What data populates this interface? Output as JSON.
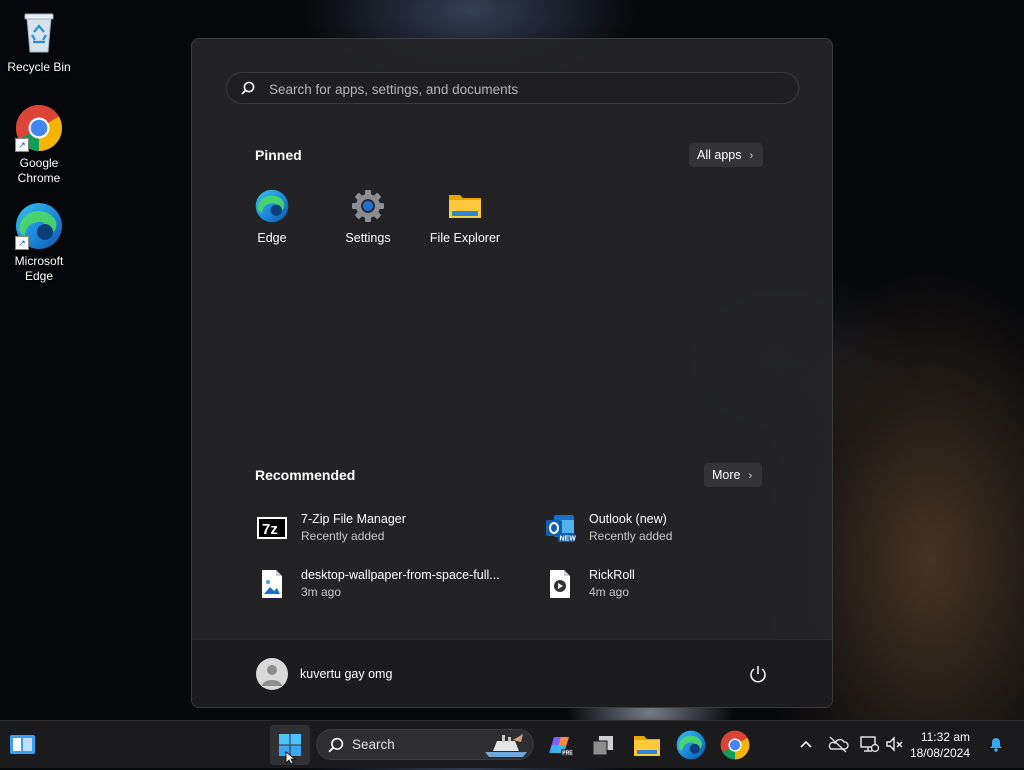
{
  "desktop": {
    "icons": [
      {
        "label": "Recycle Bin"
      },
      {
        "label": "Google Chrome"
      },
      {
        "label": "Microsoft Edge"
      }
    ]
  },
  "start_menu": {
    "search_placeholder": "Search for apps, settings, and documents",
    "pinned": {
      "title": "Pinned",
      "all_apps_label": "All apps",
      "items": [
        {
          "label": "Edge",
          "icon": "edge-icon"
        },
        {
          "label": "Settings",
          "icon": "gear-icon"
        },
        {
          "label": "File Explorer",
          "icon": "folder-icon"
        }
      ]
    },
    "recommended": {
      "title": "Recommended",
      "more_label": "More",
      "items": [
        {
          "name": "7-Zip File Manager",
          "sub": "Recently added",
          "icon": "7zip-icon"
        },
        {
          "name": "Outlook (new)",
          "sub": "Recently added",
          "icon": "outlook-icon"
        },
        {
          "name": "desktop-wallpaper-from-space-full...",
          "sub": "3m ago",
          "icon": "image-file-icon"
        },
        {
          "name": "RickRoll",
          "sub": "4m ago",
          "icon": "video-file-icon"
        }
      ]
    },
    "user": {
      "name": "kuvertu gay omg"
    }
  },
  "taskbar": {
    "search_label": "Search",
    "apps": [
      "widgets-icon",
      "start-icon",
      "copilot-icon",
      "task-view-icon",
      "file-explorer-icon",
      "edge-icon",
      "chrome-icon"
    ],
    "clock": {
      "time": "11:32 am",
      "date": "18/08/2024"
    }
  },
  "colors": {
    "accent": "#0078d4",
    "menu_bg": "#262628",
    "taskbar_bg": "#1b1b1d"
  }
}
